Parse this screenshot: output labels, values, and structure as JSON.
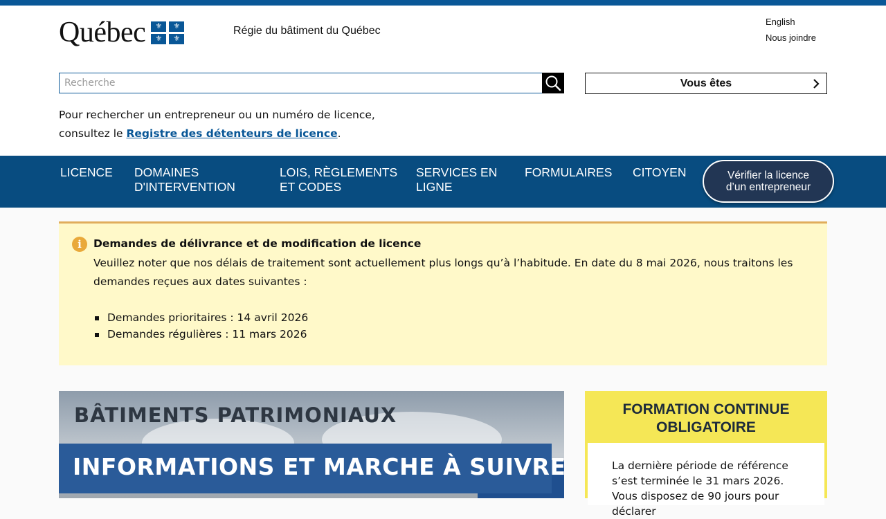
{
  "header": {
    "logo_text": "Québec",
    "org_name": "Régie du bâtiment du Québec",
    "links": [
      "English",
      "Nous joindre"
    ]
  },
  "search": {
    "placeholder": "Recherche",
    "icon": "search-icon"
  },
  "vous_etes": {
    "label": "Vous êtes",
    "icon": "chevron-right-icon"
  },
  "registre_note": {
    "line1": "Pour rechercher un entrepreneur ou un numéro de licence,",
    "line2_prefix": "consultez le ",
    "link": "Registre des détenteurs de licence",
    "suffix": "."
  },
  "nav": {
    "items": [
      {
        "line1": "LICENCE",
        "line2": ""
      },
      {
        "line1": "DOMAINES",
        "line2": "D'INTERVENTION"
      },
      {
        "line1": "LOIS, RÈGLEMENTS",
        "line2": "ET CODES"
      },
      {
        "line1": "SERVICES EN",
        "line2": "LIGNE"
      },
      {
        "line1": "FORMULAIRES",
        "line2": ""
      },
      {
        "line1": "CITOYEN",
        "line2": ""
      }
    ],
    "verify_button": {
      "line1": "Vérifier la licence",
      "line2": "d’un entrepreneur"
    },
    "background": "#084c80"
  },
  "alert": {
    "title": "Demandes de délivrance et de modification de licence",
    "body": "Veuillez noter que nos délais de traitement sont actuellement plus longs qu’à l’habitude. En date du 8 mai 2026, nous traitons les demandes reçues aux dates suivantes :",
    "items": [
      "Demandes prioritaires : 14 avril 2026",
      "Demandes régulières : 11 mars 2026"
    ],
    "icon": "info-icon",
    "background": "#fff9c9",
    "accent": "#e0ad5c"
  },
  "banner": {
    "title": "BÂTIMENTS PATRIMONIAUX",
    "subtitle": "INFORMATIONS ET MARCHE À SUIVRE"
  },
  "formation": {
    "title_line1": "FORMATION CONTINUE",
    "title_line2": "OBLIGATOIRE",
    "text": "La dernière période de référence s’est terminée le 31 mars 2026. Vous disposez de 90 jours pour déclarer",
    "background": "#f5e756"
  }
}
